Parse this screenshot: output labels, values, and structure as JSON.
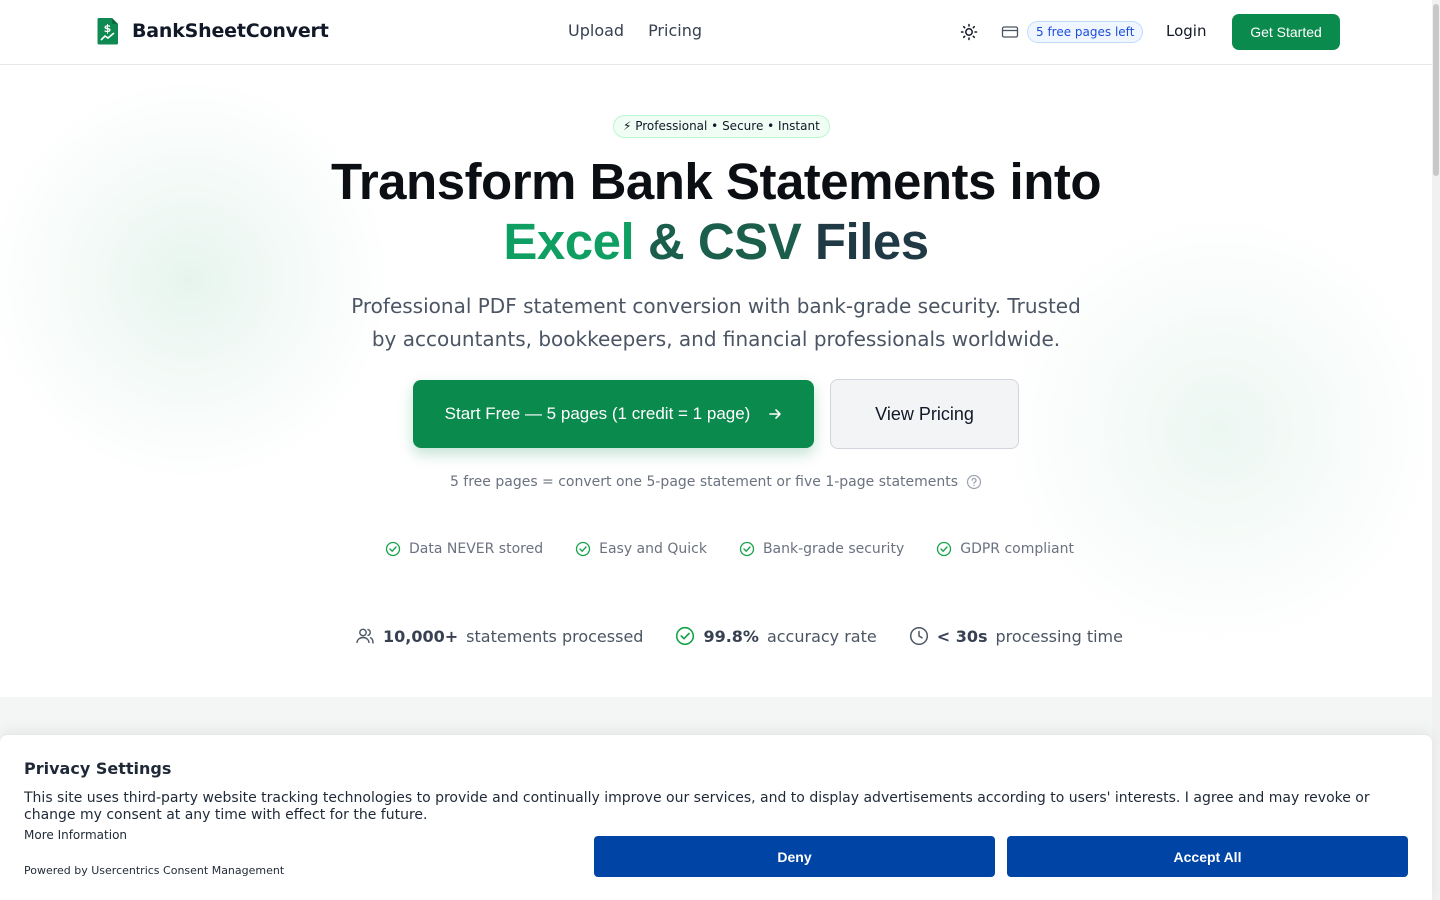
{
  "header": {
    "brand": "BankSheetConvert",
    "nav": [
      "Upload",
      "Pricing"
    ],
    "credits_badge": "5 free pages left",
    "login": "Login",
    "get_started": "Get Started"
  },
  "hero": {
    "tagline": "⚡ Professional • Secure • Instant",
    "title_line1": "Transform Bank Statements into",
    "title_part_a": "Excel",
    "title_part_b": " &",
    "title_part_c": " CSV",
    "title_part_d": " Files",
    "subtitle": "Professional PDF statement conversion with bank-grade security. Trusted by accountants, bookkeepers, and financial professionals worldwide.",
    "cta_primary": "Start Free — 5 pages (1 credit = 1 page)",
    "cta_secondary": "View Pricing",
    "note": "5 free pages = convert one 5-page statement or five 1-page statements"
  },
  "features": [
    "Data NEVER stored",
    "Easy and Quick",
    "Bank-grade security",
    "GDPR compliant"
  ],
  "stats": [
    {
      "value": "10,000+",
      "label": "statements processed"
    },
    {
      "value": "99.8%",
      "label": "accuracy rate"
    },
    {
      "value": "< 30s",
      "label": "processing time"
    }
  ],
  "consent": {
    "title": "Privacy Settings",
    "text": "This site uses third-party website tracking technologies to provide and continually improve our services, and to display advertisements according to users' interests. I agree and may revoke or change my consent at any time with effect for the future.",
    "more_info": "More Information",
    "powered_by": "Powered by Usercentrics Consent Management",
    "deny": "Deny",
    "accept": "Accept All"
  },
  "colors": {
    "brand_green": "#0b8a4e",
    "consent_blue": "#0045a5"
  }
}
